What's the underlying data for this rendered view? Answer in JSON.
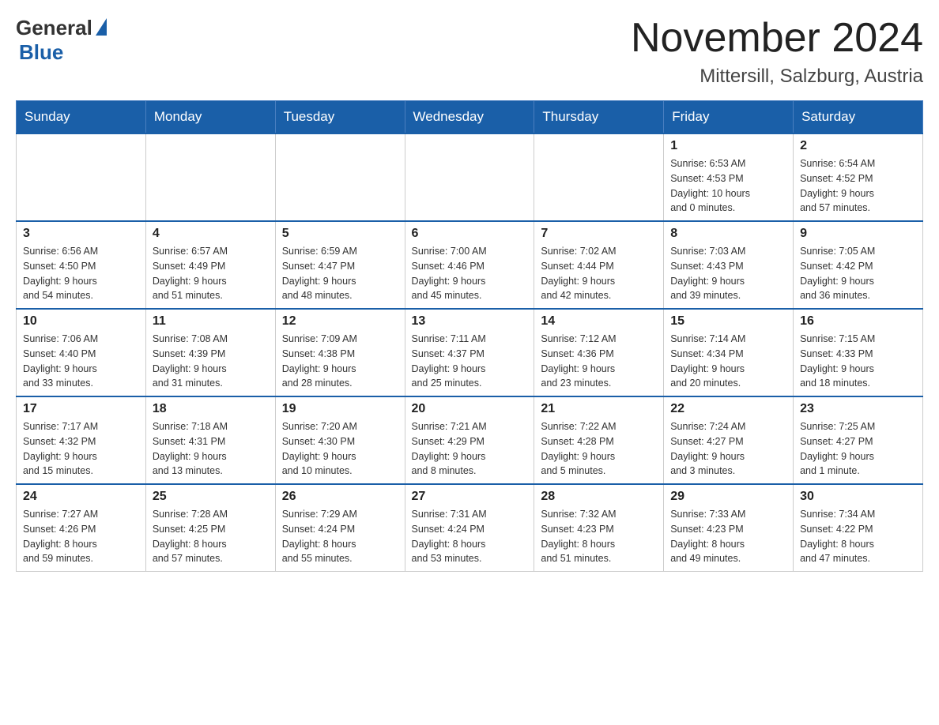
{
  "header": {
    "logo_text": "General",
    "logo_blue": "Blue",
    "month": "November 2024",
    "location": "Mittersill, Salzburg, Austria"
  },
  "days_of_week": [
    "Sunday",
    "Monday",
    "Tuesday",
    "Wednesday",
    "Thursday",
    "Friday",
    "Saturday"
  ],
  "weeks": [
    [
      {
        "day": "",
        "info": ""
      },
      {
        "day": "",
        "info": ""
      },
      {
        "day": "",
        "info": ""
      },
      {
        "day": "",
        "info": ""
      },
      {
        "day": "",
        "info": ""
      },
      {
        "day": "1",
        "info": "Sunrise: 6:53 AM\nSunset: 4:53 PM\nDaylight: 10 hours\nand 0 minutes."
      },
      {
        "day": "2",
        "info": "Sunrise: 6:54 AM\nSunset: 4:52 PM\nDaylight: 9 hours\nand 57 minutes."
      }
    ],
    [
      {
        "day": "3",
        "info": "Sunrise: 6:56 AM\nSunset: 4:50 PM\nDaylight: 9 hours\nand 54 minutes."
      },
      {
        "day": "4",
        "info": "Sunrise: 6:57 AM\nSunset: 4:49 PM\nDaylight: 9 hours\nand 51 minutes."
      },
      {
        "day": "5",
        "info": "Sunrise: 6:59 AM\nSunset: 4:47 PM\nDaylight: 9 hours\nand 48 minutes."
      },
      {
        "day": "6",
        "info": "Sunrise: 7:00 AM\nSunset: 4:46 PM\nDaylight: 9 hours\nand 45 minutes."
      },
      {
        "day": "7",
        "info": "Sunrise: 7:02 AM\nSunset: 4:44 PM\nDaylight: 9 hours\nand 42 minutes."
      },
      {
        "day": "8",
        "info": "Sunrise: 7:03 AM\nSunset: 4:43 PM\nDaylight: 9 hours\nand 39 minutes."
      },
      {
        "day": "9",
        "info": "Sunrise: 7:05 AM\nSunset: 4:42 PM\nDaylight: 9 hours\nand 36 minutes."
      }
    ],
    [
      {
        "day": "10",
        "info": "Sunrise: 7:06 AM\nSunset: 4:40 PM\nDaylight: 9 hours\nand 33 minutes."
      },
      {
        "day": "11",
        "info": "Sunrise: 7:08 AM\nSunset: 4:39 PM\nDaylight: 9 hours\nand 31 minutes."
      },
      {
        "day": "12",
        "info": "Sunrise: 7:09 AM\nSunset: 4:38 PM\nDaylight: 9 hours\nand 28 minutes."
      },
      {
        "day": "13",
        "info": "Sunrise: 7:11 AM\nSunset: 4:37 PM\nDaylight: 9 hours\nand 25 minutes."
      },
      {
        "day": "14",
        "info": "Sunrise: 7:12 AM\nSunset: 4:36 PM\nDaylight: 9 hours\nand 23 minutes."
      },
      {
        "day": "15",
        "info": "Sunrise: 7:14 AM\nSunset: 4:34 PM\nDaylight: 9 hours\nand 20 minutes."
      },
      {
        "day": "16",
        "info": "Sunrise: 7:15 AM\nSunset: 4:33 PM\nDaylight: 9 hours\nand 18 minutes."
      }
    ],
    [
      {
        "day": "17",
        "info": "Sunrise: 7:17 AM\nSunset: 4:32 PM\nDaylight: 9 hours\nand 15 minutes."
      },
      {
        "day": "18",
        "info": "Sunrise: 7:18 AM\nSunset: 4:31 PM\nDaylight: 9 hours\nand 13 minutes."
      },
      {
        "day": "19",
        "info": "Sunrise: 7:20 AM\nSunset: 4:30 PM\nDaylight: 9 hours\nand 10 minutes."
      },
      {
        "day": "20",
        "info": "Sunrise: 7:21 AM\nSunset: 4:29 PM\nDaylight: 9 hours\nand 8 minutes."
      },
      {
        "day": "21",
        "info": "Sunrise: 7:22 AM\nSunset: 4:28 PM\nDaylight: 9 hours\nand 5 minutes."
      },
      {
        "day": "22",
        "info": "Sunrise: 7:24 AM\nSunset: 4:27 PM\nDaylight: 9 hours\nand 3 minutes."
      },
      {
        "day": "23",
        "info": "Sunrise: 7:25 AM\nSunset: 4:27 PM\nDaylight: 9 hours\nand 1 minute."
      }
    ],
    [
      {
        "day": "24",
        "info": "Sunrise: 7:27 AM\nSunset: 4:26 PM\nDaylight: 8 hours\nand 59 minutes."
      },
      {
        "day": "25",
        "info": "Sunrise: 7:28 AM\nSunset: 4:25 PM\nDaylight: 8 hours\nand 57 minutes."
      },
      {
        "day": "26",
        "info": "Sunrise: 7:29 AM\nSunset: 4:24 PM\nDaylight: 8 hours\nand 55 minutes."
      },
      {
        "day": "27",
        "info": "Sunrise: 7:31 AM\nSunset: 4:24 PM\nDaylight: 8 hours\nand 53 minutes."
      },
      {
        "day": "28",
        "info": "Sunrise: 7:32 AM\nSunset: 4:23 PM\nDaylight: 8 hours\nand 51 minutes."
      },
      {
        "day": "29",
        "info": "Sunrise: 7:33 AM\nSunset: 4:23 PM\nDaylight: 8 hours\nand 49 minutes."
      },
      {
        "day": "30",
        "info": "Sunrise: 7:34 AM\nSunset: 4:22 PM\nDaylight: 8 hours\nand 47 minutes."
      }
    ]
  ]
}
